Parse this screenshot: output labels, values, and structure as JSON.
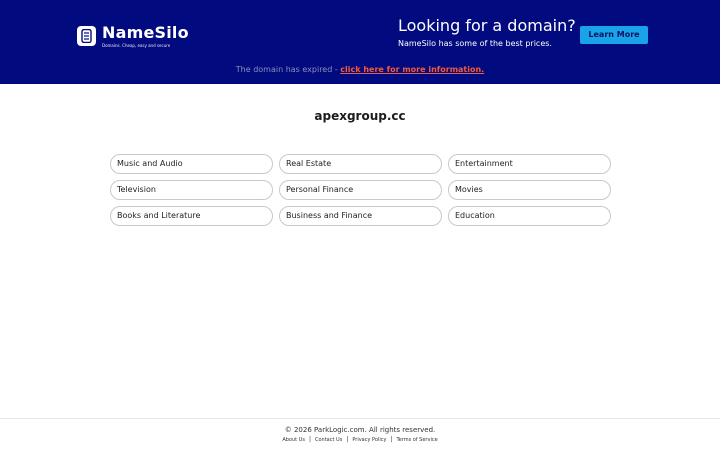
{
  "header": {
    "logo_name": "NameSilo",
    "logo_tagline": "Domains. Cheap, easy and secure",
    "promo_title": "Looking for a domain?",
    "promo_subtitle": "NameSilo has some of the best prices.",
    "learn_more_label": "Learn More",
    "background_color": "#020a80",
    "button_color": "#19a3e8"
  },
  "notice": {
    "text": "The domain has expired - ",
    "link_text": "click here for more information.",
    "link_color": "#f45a3c"
  },
  "domain": "apexgroup.cc",
  "categories": [
    "Music and Audio",
    "Real Estate",
    "Entertainment",
    "Television",
    "Personal Finance",
    "Movies",
    "Books and Literature",
    "Business and Finance",
    "Education"
  ],
  "footer": {
    "copyright": "© 2026 ParkLogic.com. All rights reserved.",
    "links": [
      "About Us",
      "Contact Us",
      "Privacy Policy",
      "Terms of Service"
    ],
    "separator": "|"
  },
  "icons": {
    "logo": "server-icon"
  }
}
